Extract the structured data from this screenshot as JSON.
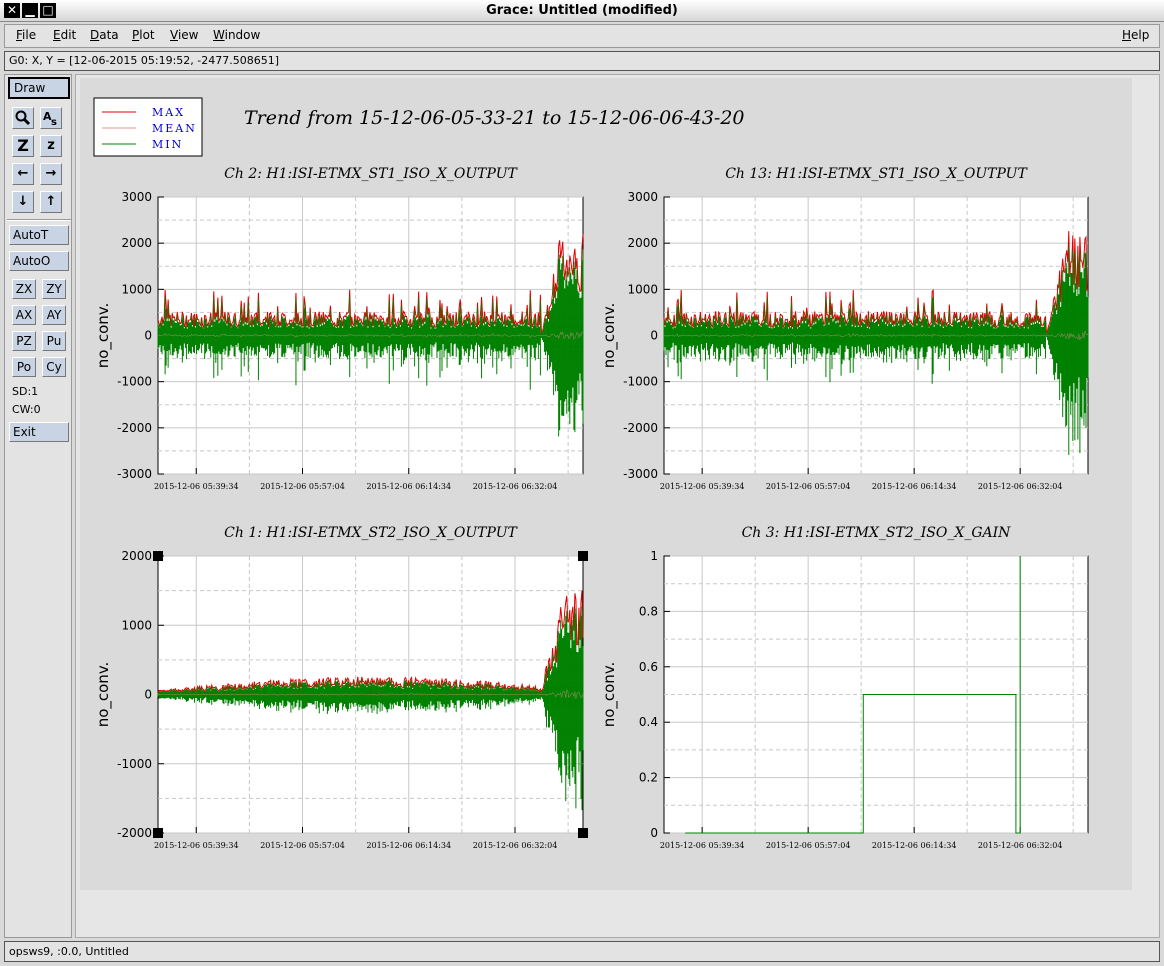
{
  "window": {
    "title": "Grace: Untitled (modified)",
    "close_glyph": "✕",
    "minimize_glyph": "▁",
    "maximize_glyph": "□"
  },
  "menu": {
    "items": [
      "File",
      "Edit",
      "Data",
      "Plot",
      "View",
      "Window"
    ],
    "help": "Help"
  },
  "locator": {
    "text": "G0: X, Y = [12-06-2015 05:19:52, -2477.508651]"
  },
  "tools": {
    "draw": "Draw",
    "icons": [
      "zoom-icon",
      "text-icon",
      "zoom-z-icon",
      "zoom-z-small-icon",
      "arrow-left-icon",
      "arrow-right-icon",
      "arrow-down-icon",
      "arrow-up-icon"
    ],
    "autot": "AutoT",
    "autoo": "AutoO",
    "small": [
      "ZX",
      "ZY",
      "AX",
      "AY",
      "PZ",
      "Pu",
      "Po",
      "Cy"
    ],
    "sd": "SD:1",
    "cw": "CW:0",
    "exit": "Exit"
  },
  "status": {
    "text": "opsws9, :0.0, Untitled"
  },
  "plot": {
    "title": "Trend from 15-12-06-05-33-21 to 15-12-06-06-43-20",
    "legend": [
      "MAX",
      "MEAN",
      "MIN"
    ],
    "colors": {
      "max": "#e00000",
      "mean": "#e09090",
      "min": "#008000",
      "legend_text": "#0000cc",
      "grid": "#c8c8c8"
    }
  },
  "chart_data": [
    {
      "type": "line",
      "title": "Ch 2: H1:ISI-ETMX_ST1_ISO_X_OUTPUT",
      "ylabel": "no_conv.",
      "ylim": [
        -3000,
        3000
      ],
      "yticks": [
        "3000",
        "2000",
        "1000",
        "0",
        "-1000",
        "-2000",
        "-3000"
      ],
      "xticks": [
        "2015-12-06 05:39:34",
        "2015-12-06 05:57:04",
        "2015-12-06 06:14:34",
        "2015-12-06 06:32:04"
      ],
      "series": [
        {
          "name": "MAX"
        },
        {
          "name": "MEAN"
        },
        {
          "name": "MIN"
        }
      ],
      "noise": {
        "base": 350,
        "spike": 1000,
        "end": 2300
      }
    },
    {
      "type": "line",
      "title": "Ch 13: H1:ISI-ETMX_ST1_ISO_X_OUTPUT",
      "ylabel": "no_conv.",
      "ylim": [
        -3000,
        3000
      ],
      "yticks": [
        "3000",
        "2000",
        "1000",
        "0",
        "-1000",
        "-2000",
        "-3000"
      ],
      "xticks": [
        "2015-12-06 05:39:34",
        "2015-12-06 05:57:04",
        "2015-12-06 06:14:34",
        "2015-12-06 06:32:04"
      ],
      "series": [
        {
          "name": "MAX"
        },
        {
          "name": "MEAN"
        },
        {
          "name": "MIN"
        }
      ],
      "noise": {
        "base": 350,
        "spike": 1000,
        "end": 2300
      }
    },
    {
      "type": "line",
      "title": "Ch 1: H1:ISI-ETMX_ST2_ISO_X_OUTPUT",
      "ylabel": "no_conv.",
      "ylim": [
        -2000,
        2000
      ],
      "yticks": [
        "2000",
        "1000",
        "0",
        "-1000",
        "-2000"
      ],
      "xticks": [
        "2015-12-06 05:39:34",
        "2015-12-06 05:57:04",
        "2015-12-06 06:14:34",
        "2015-12-06 06:32:04"
      ],
      "series": [
        {
          "name": "MAX"
        },
        {
          "name": "MEAN"
        },
        {
          "name": "MIN"
        }
      ],
      "noise": {
        "base": 40,
        "spike": 150,
        "end": 1500
      }
    },
    {
      "type": "line",
      "title": "Ch 3: H1:ISI-ETMX_ST2_ISO_X_GAIN",
      "ylabel": "no_conv.",
      "ylim": [
        0,
        1
      ],
      "yticks": [
        "1",
        "0.8",
        "0.6",
        "0.4",
        "0.2",
        "0"
      ],
      "xticks": [
        "2015-12-06 05:39:34",
        "2015-12-06 05:57:04",
        "2015-12-06 06:14:34",
        "2015-12-06 06:32:04"
      ],
      "step": [
        [
          0,
          0
        ],
        [
          0.42,
          0
        ],
        [
          0.42,
          0.5
        ],
        [
          0.78,
          0.5
        ],
        [
          0.78,
          0
        ],
        [
          0.79,
          0
        ],
        [
          0.79,
          1
        ]
      ]
    }
  ]
}
